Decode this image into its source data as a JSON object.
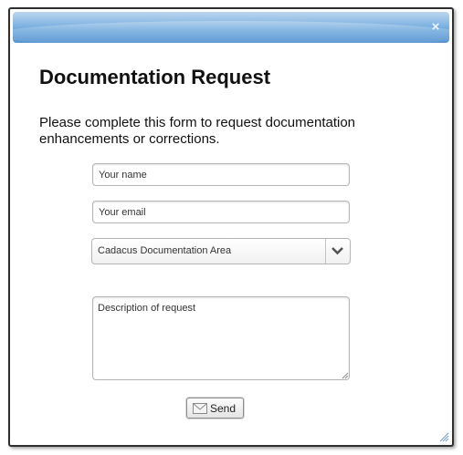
{
  "dialog": {
    "close_glyph": "×",
    "heading": "Documentation Request",
    "intro": "Please complete this form to request documentation enhancements or corrections."
  },
  "form": {
    "name_placeholder": "Your name",
    "email_placeholder": "Your email",
    "area_select": {
      "selected": "Cadacus Documentation Area",
      "icon": "chevron-down-icon"
    },
    "description_placeholder": "Description of request",
    "send_label": "Send",
    "send_icon": "envelope-icon"
  },
  "colors": {
    "titlebar": "#6aa5db",
    "border": "#2f2f2f"
  }
}
